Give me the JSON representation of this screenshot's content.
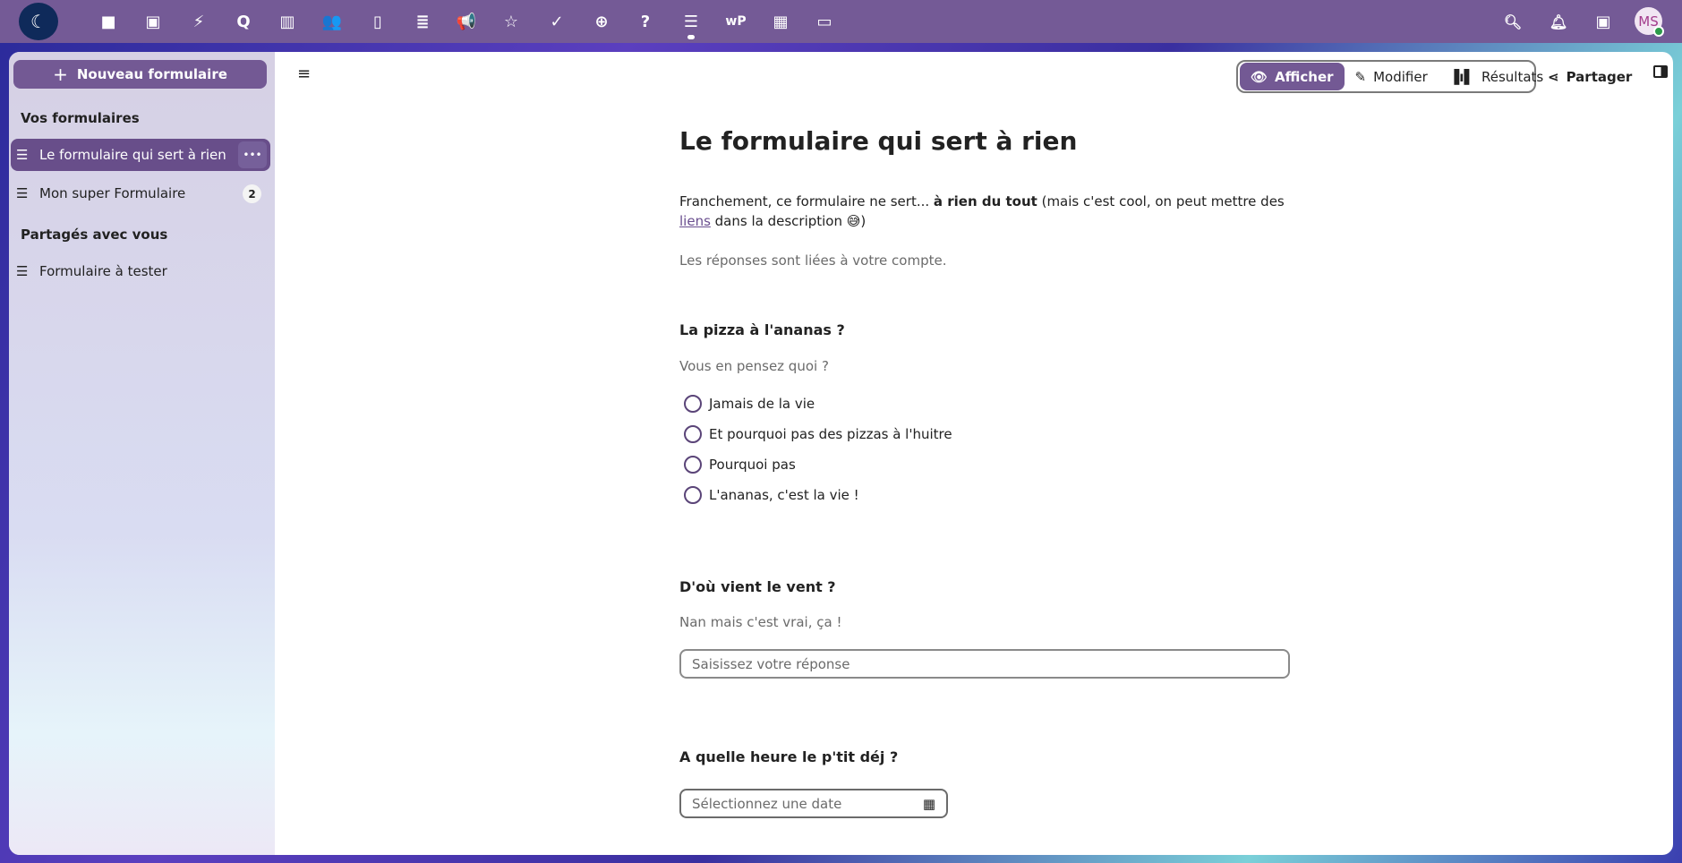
{
  "topbar": {
    "apps": [
      "files-icon",
      "photos-icon",
      "activity-icon",
      "search-talk-icon",
      "deck-icon",
      "contacts-icon",
      "calendar-icon",
      "archive-icon",
      "announcements-icon",
      "cospend-icon",
      "tasks-icon",
      "help-center-icon",
      "help-icon",
      "forms-icon",
      "wordpress-icon",
      "tables-icon",
      "desktop-icon"
    ],
    "avatar_initials": "MS"
  },
  "sidebar": {
    "new_button": "Nouveau formulaire",
    "section_mine": "Vos formulaires",
    "section_shared": "Partagés avec vous",
    "items": [
      {
        "label": "Le formulaire qui sert à rien"
      },
      {
        "label": "Mon super Formulaire",
        "badge": "2"
      }
    ],
    "shared_items": [
      {
        "label": "Formulaire à tester"
      }
    ]
  },
  "toolbar": {
    "view": "Afficher",
    "edit": "Modifier",
    "results": "Résultats",
    "share": "Partager"
  },
  "form": {
    "title": "Le formulaire qui sert à rien",
    "desc_a": "Franchement, ce formulaire ne sert... ",
    "desc_bold": "à rien du tout",
    "desc_b": " (mais c'est cool, on peut mettre des ",
    "desc_link": "liens",
    "desc_c": " dans la description ",
    "desc_emoji": "😅",
    "desc_d": ")",
    "account_note": "Les réponses sont liées à votre compte.",
    "q1": {
      "title": "La pizza à l'ananas ?",
      "subtitle": "Vous en pensez quoi ?",
      "options": [
        "Jamais de la vie",
        "Et pourquoi pas des pizzas à l'huitre",
        "Pourquoi pas",
        "L'ananas, c'est la vie !"
      ]
    },
    "q2": {
      "title": "D'où vient le vent ?",
      "subtitle": "Nan mais c'est vrai, ça !",
      "placeholder": "Saisissez votre réponse"
    },
    "q3": {
      "title": "A quelle heure le p'tit déj ?",
      "placeholder": "Sélectionnez une date"
    }
  },
  "colors": {
    "primary": "#745a96",
    "active": "#684e8a"
  }
}
